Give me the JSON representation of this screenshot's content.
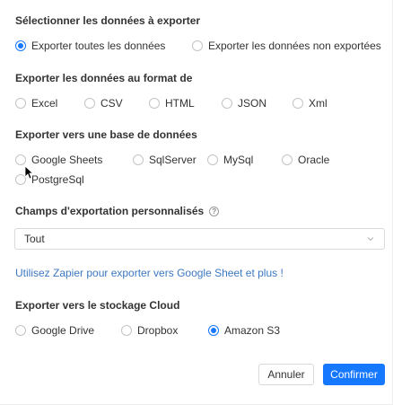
{
  "export_data": {
    "title": "Sélectionner les données à exporter",
    "options": [
      {
        "label": "Exporter toutes les données",
        "checked": true
      },
      {
        "label": "Exporter les données non exportées",
        "checked": false
      }
    ]
  },
  "format": {
    "title": "Exporter les données au format de",
    "options": [
      {
        "label": "Excel",
        "checked": false
      },
      {
        "label": "CSV",
        "checked": false
      },
      {
        "label": "HTML",
        "checked": false
      },
      {
        "label": "JSON",
        "checked": false
      },
      {
        "label": "Xml",
        "checked": false
      }
    ]
  },
  "database": {
    "title": "Exporter vers une base de données",
    "options": [
      {
        "label": "Google Sheets",
        "checked": false
      },
      {
        "label": "SqlServer",
        "checked": false
      },
      {
        "label": "MySql",
        "checked": false
      },
      {
        "label": "Oracle",
        "checked": false
      },
      {
        "label": "PostgreSql",
        "checked": false
      }
    ]
  },
  "custom_fields": {
    "title": "Champs d'exportation personnalisés",
    "help_icon": "?",
    "selected": "Tout"
  },
  "zapier_link": "Utilisez Zapier pour exporter vers Google Sheet et plus !",
  "cloud": {
    "title": "Exporter vers le stockage Cloud",
    "options": [
      {
        "label": "Google Drive",
        "checked": false
      },
      {
        "label": "Dropbox",
        "checked": false
      },
      {
        "label": "Amazon S3",
        "checked": true
      }
    ]
  },
  "buttons": {
    "cancel": "Annuler",
    "confirm": "Confirmer"
  },
  "colors": {
    "accent": "#1677ff",
    "link": "#3c78c3"
  }
}
